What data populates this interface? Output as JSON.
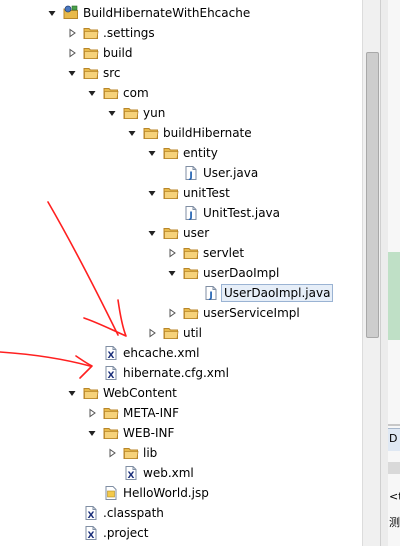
{
  "colors": {
    "folder": "#e8b94a",
    "folder_edge": "#b8862a",
    "java_badge": "#2060b0",
    "xml_badge": "#1b2f7a",
    "annotation_red": "#ff2020",
    "selection_bg": "#e6eef8"
  },
  "tree": [
    {
      "label": "BuildHibernateWithEhcache",
      "icon": "project-icon",
      "expanded": true,
      "name": "project-root"
    },
    {
      "label": ".settings",
      "icon": "folder-icon",
      "expanded": false,
      "name": "folder-settings"
    },
    {
      "label": "build",
      "icon": "folder-icon",
      "expanded": false,
      "name": "folder-build"
    },
    {
      "label": "src",
      "icon": "folder-icon",
      "expanded": true,
      "name": "folder-src"
    },
    {
      "label": "com",
      "icon": "folder-icon",
      "expanded": true,
      "name": "folder-com"
    },
    {
      "label": "yun",
      "icon": "folder-icon",
      "expanded": true,
      "name": "folder-yun"
    },
    {
      "label": "buildHibernate",
      "icon": "folder-icon",
      "expanded": true,
      "name": "folder-buildhibernate"
    },
    {
      "label": "entity",
      "icon": "folder-icon",
      "expanded": true,
      "name": "folder-entity"
    },
    {
      "label": "User.java",
      "icon": "java-file-icon",
      "name": "file-user-java"
    },
    {
      "label": "unitTest",
      "icon": "folder-icon",
      "expanded": true,
      "name": "folder-unittest"
    },
    {
      "label": "UnitTest.java",
      "icon": "java-file-icon",
      "name": "file-unittest-java"
    },
    {
      "label": "user",
      "icon": "folder-icon",
      "expanded": true,
      "name": "folder-user"
    },
    {
      "label": "servlet",
      "icon": "folder-icon",
      "expanded": false,
      "name": "folder-servlet"
    },
    {
      "label": "userDaoImpl",
      "icon": "folder-icon",
      "expanded": true,
      "name": "folder-userdaoimpl"
    },
    {
      "label": "UserDaoImpl.java",
      "icon": "java-file-icon",
      "selected": true,
      "name": "file-userdaoimpl-java"
    },
    {
      "label": "userServiceImpl",
      "icon": "folder-icon",
      "expanded": false,
      "name": "folder-userserviceimpl"
    },
    {
      "label": "util",
      "icon": "folder-icon",
      "expanded": false,
      "name": "folder-util"
    },
    {
      "label": "ehcache.xml",
      "icon": "xml-file-icon",
      "name": "file-ehcache-xml"
    },
    {
      "label": "hibernate.cfg.xml",
      "icon": "xml-file-icon",
      "name": "file-hibernate-cfg-xml"
    },
    {
      "label": "WebContent",
      "icon": "folder-icon",
      "expanded": true,
      "name": "folder-webcontent"
    },
    {
      "label": "META-INF",
      "icon": "folder-icon",
      "expanded": false,
      "name": "folder-meta-inf"
    },
    {
      "label": "WEB-INF",
      "icon": "folder-icon",
      "expanded": true,
      "name": "folder-web-inf"
    },
    {
      "label": "lib",
      "icon": "folder-icon",
      "expanded": false,
      "name": "folder-lib"
    },
    {
      "label": "web.xml",
      "icon": "xml-file-icon",
      "name": "file-web-xml"
    },
    {
      "label": "HelloWorld.jsp",
      "icon": "jsp-file-icon",
      "name": "file-helloworld-jsp"
    },
    {
      "label": ".classpath",
      "icon": "xml-file-icon",
      "name": "file-classpath"
    },
    {
      "label": ".project",
      "icon": "xml-file-icon",
      "name": "file-project"
    }
  ],
  "right_panel": {
    "tab_letter": "D",
    "lt_text": "<t",
    "char_text": "测"
  }
}
